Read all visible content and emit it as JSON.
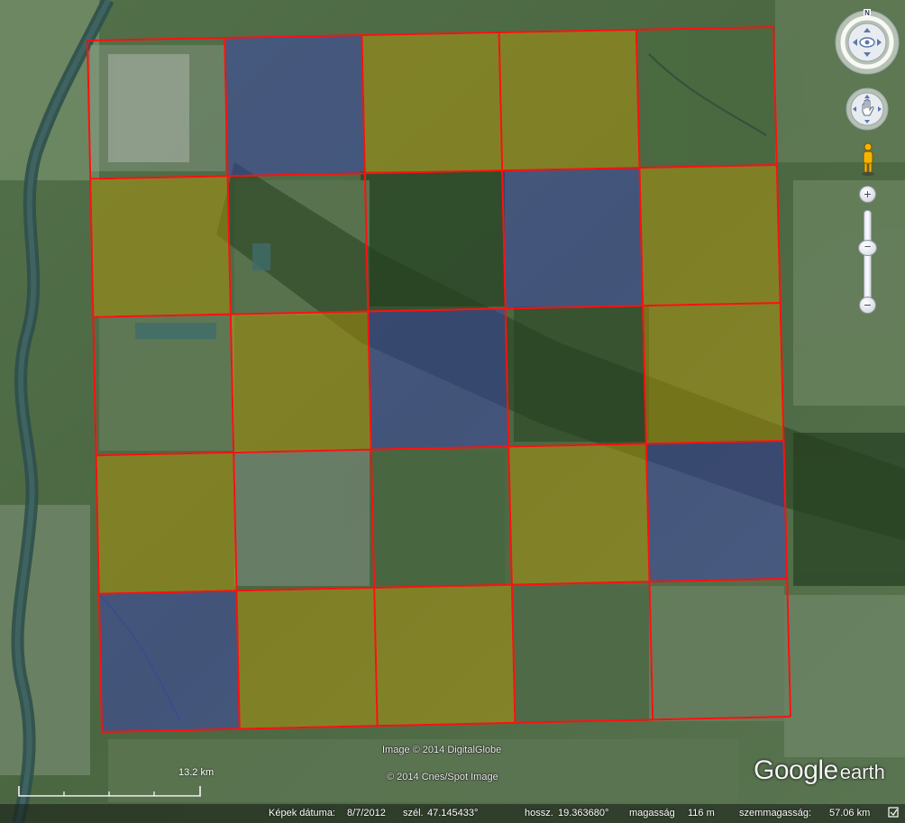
{
  "map": {
    "imagery_attribution": "Image © 2014 DigitalGlobe",
    "imagery_attribution_2": "© 2014 Cnes/Spot Image",
    "logo": {
      "main": "Google",
      "sub": "earth"
    },
    "scale": {
      "label": "13.2 km"
    },
    "status": {
      "date_label": "Képek dátuma:",
      "date_value": "8/7/2012",
      "lat_label": "szél.",
      "lat_value": "47.145433°",
      "lon_label": "hossz.",
      "lon_value": "19.363680°",
      "elev_label": "magasság",
      "elev_value": "116 m",
      "eye_label": "szemmagasság:",
      "eye_value": "57.06 km"
    },
    "navigation": {
      "north_label": "N",
      "zoom_in": "+",
      "zoom_out": "−",
      "zoom_thumb": "−"
    },
    "grid": {
      "rows": 5,
      "cols": 5,
      "line_color": "#ff1010",
      "overlay_colors": {
        "blue": "#3a3cc8",
        "yellow": "#c8a300",
        "none": "transparent"
      },
      "cells": [
        [
          "none",
          "blue",
          "yellow",
          "yellow",
          "none"
        ],
        [
          "yellow",
          "none",
          "none",
          "blue",
          "yellow"
        ],
        [
          "none",
          "yellow",
          "blue",
          "none",
          "yellow"
        ],
        [
          "yellow",
          "none",
          "none",
          "yellow",
          "blue"
        ],
        [
          "blue",
          "yellow",
          "yellow",
          "none",
          "none"
        ]
      ]
    }
  }
}
